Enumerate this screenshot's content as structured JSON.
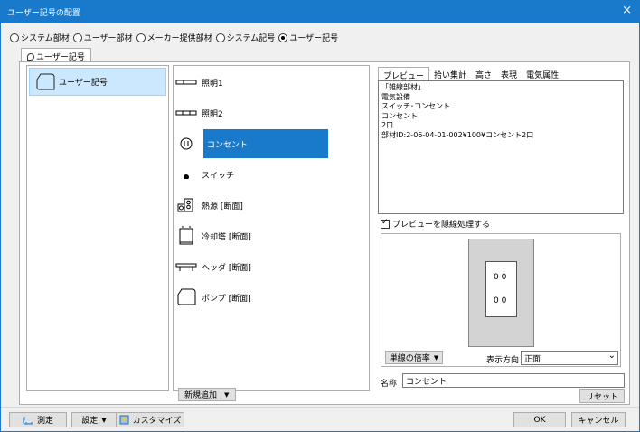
{
  "window": {
    "title": "ユーザー記号の配置",
    "close_glyph": "×"
  },
  "radios": [
    {
      "label": "システム部材",
      "selected": false
    },
    {
      "label": "ユーザー部材",
      "selected": false
    },
    {
      "label": "メーカー提供部材",
      "selected": false
    },
    {
      "label": "システム記号",
      "selected": false
    },
    {
      "label": "ユーザー記号",
      "selected": true
    }
  ],
  "tab": {
    "label": "ユーザー記号"
  },
  "categories": [
    {
      "label": "ユーザー記号",
      "selected": true
    }
  ],
  "items": [
    {
      "label": "照明1",
      "icon": "light1-symbol"
    },
    {
      "label": "照明2",
      "icon": "light2-symbol"
    },
    {
      "label": "コンセント",
      "icon": "outlet-symbol",
      "selected": true
    },
    {
      "label": "スイッチ",
      "icon": "switch-symbol"
    },
    {
      "label": "熱源 [断面]",
      "icon": "heat-source-symbol"
    },
    {
      "label": "冷却塔 [断面]",
      "icon": "cooling-tower-symbol"
    },
    {
      "label": "ヘッダ [断面]",
      "icon": "header-symbol"
    },
    {
      "label": "ポンプ [断面]",
      "icon": "pump-symbol"
    }
  ],
  "add_button": {
    "label": "新規追加",
    "arrow": "▼"
  },
  "right_tabs": [
    "プレビュー",
    "拾い集計",
    "高さ",
    "表現",
    "電気属性"
  ],
  "preview_lines": [
    "「雑線部材」",
    "電気設備",
    "スイッチ･コンセント",
    "コンセント",
    "2口",
    "部材ID:2-06-04-01-002¥100¥コンセント2口"
  ],
  "hidden_line_checkbox": {
    "label": "プレビューを隠線処理する",
    "checked": true
  },
  "outlet_slots": [
    "0 0",
    "0 0"
  ],
  "scale_dropdown": {
    "label": "単線の倍率",
    "arrow": "▼"
  },
  "direction": {
    "label": "表示方向",
    "value": "正面",
    "arrow": "⌄"
  },
  "name_field": {
    "label": "名称",
    "value": "コンセント"
  },
  "reset_button": {
    "label": "リセット"
  },
  "footer": {
    "measure_label": "測定",
    "settings_label": "設定",
    "settings_arrow": "▼",
    "customize_label": "カスタマイズ",
    "ok_label": "OK",
    "cancel_label": "キャンセル"
  }
}
